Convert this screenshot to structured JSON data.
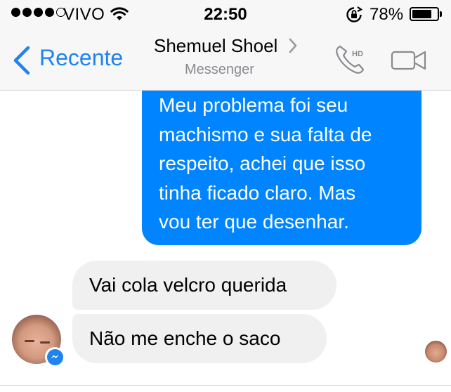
{
  "status_bar": {
    "carrier": "VIVO",
    "time": "22:50",
    "battery_percent": "78%",
    "battery_level": 0.78,
    "signal_bars_filled": 4,
    "signal_bars_total": 5
  },
  "nav": {
    "back_label": "Recente",
    "contact_name": "Shemuel Shoel",
    "subtitle": "Messenger",
    "call_badge": "HD"
  },
  "messages": [
    {
      "direction": "outgoing",
      "text": "Meu problema foi seu\nmachismo e sua falta de\nrespeito, achei que isso\ntinha ficado claro. Mas\nvou ter que desenhar."
    },
    {
      "direction": "incoming",
      "text": "Vai cola velcro querida"
    },
    {
      "direction": "incoming",
      "text": "Não me enche o saco"
    }
  ],
  "colors": {
    "accent": "#1f83f0",
    "outgoing_bubble": "#0084ff",
    "incoming_bubble": "#f1f0f0",
    "header_bg": "#f7f7f8",
    "subtitle": "#8a8a8f"
  },
  "icons": {
    "back": "chevron-left-icon",
    "call": "phone-hd-icon",
    "video": "video-camera-icon",
    "wifi": "wifi-icon",
    "rotation_lock": "rotation-lock-icon",
    "messenger_badge": "messenger-icon"
  }
}
